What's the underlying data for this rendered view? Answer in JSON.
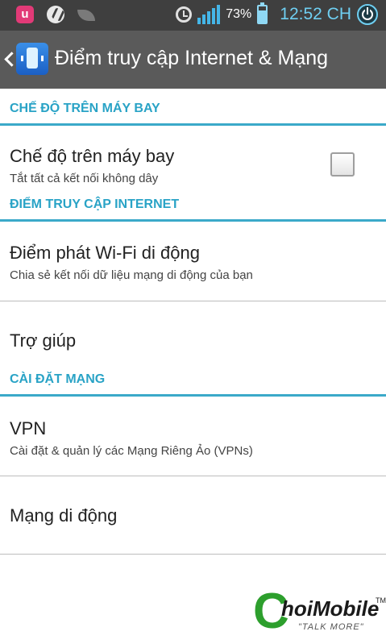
{
  "status_bar": {
    "battery_percent": "73%",
    "battery_level": 0.73,
    "time": "12:52 CH",
    "signal_bars": 5,
    "icons": [
      "u-plus-icon",
      "s-sync-icon",
      "leaf-icon",
      "alarm-icon",
      "signal-icon",
      "battery-icon",
      "power-icon"
    ]
  },
  "title_bar": {
    "title": "Điểm truy cập Internet & Mạng",
    "back_icon": "chevron-left-icon",
    "app_icon": "network-phone-icon"
  },
  "sections": [
    {
      "header": "CHẾ ĐỘ TRÊN MÁY BAY",
      "items": [
        {
          "primary": "Chế độ trên máy bay",
          "secondary": "Tắt tất cả kết nối không dây",
          "checkbox_checked": false
        }
      ]
    },
    {
      "header": "ĐIỂM TRUY CẬP INTERNET",
      "items": [
        {
          "primary": "Điểm phát Wi-Fi di động",
          "secondary": "Chia sẻ kết nối dữ liệu mạng di động của bạn"
        },
        {
          "primary": "Trợ giúp"
        }
      ]
    },
    {
      "header": "CÀI ĐẶT MẠNG",
      "items": [
        {
          "primary": "VPN",
          "secondary": "Cài đặt & quản lý các Mạng Riêng Ảo (VPNs)"
        },
        {
          "primary": "Mạng di động"
        }
      ]
    }
  ],
  "watermark": {
    "brand": "hoiMobile",
    "letter": "C",
    "tagline": "\"TALK MORE\"",
    "tm": "TM"
  },
  "colors": {
    "status_bar": "#3f3f3f",
    "title_bar": "#5a5a5a",
    "accent": "#29a3c6",
    "signal": "#45b6e8",
    "brand_green": "#2d9f2d"
  }
}
